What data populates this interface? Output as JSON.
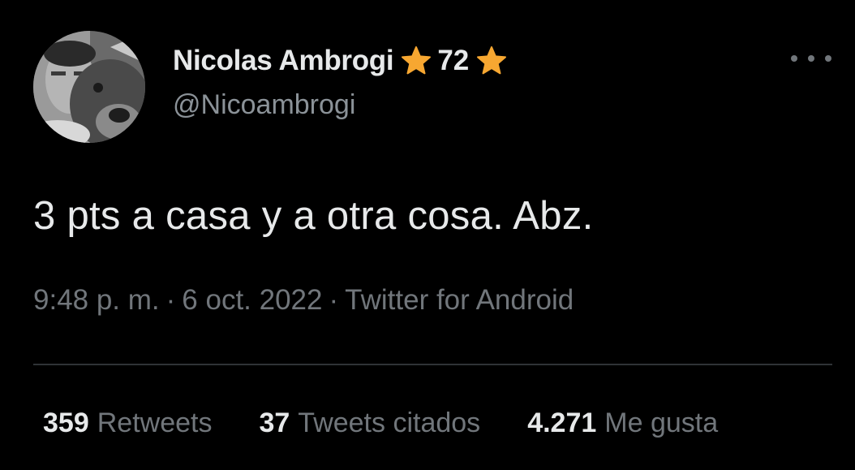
{
  "tweet": {
    "author": {
      "display_name": "Nicolas Ambrogi",
      "name_suffix_number": "72",
      "handle": "@Nicoambrogi",
      "emoji_icon": "star-icon",
      "emoji_color": "#f7a731"
    },
    "text": "3 pts a casa y a otra cosa. Abz.",
    "meta": {
      "time": "9:48 p. m.",
      "separator": "·",
      "date": "6 oct. 2022",
      "source": "Twitter for Android"
    },
    "stats": [
      {
        "value": "359",
        "label": "Retweets"
      },
      {
        "value": "37",
        "label": "Tweets citados"
      },
      {
        "value": "4.271",
        "label": "Me gusta"
      }
    ],
    "more_icon": "more-horizontal-icon"
  },
  "colors": {
    "background": "#000000",
    "primary_text": "#e7e9ea",
    "secondary_text": "#71767b",
    "divider": "#2f3336"
  }
}
